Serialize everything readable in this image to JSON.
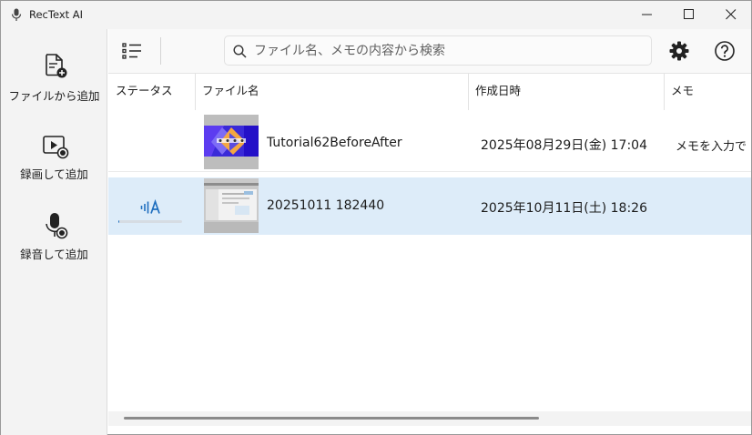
{
  "window": {
    "title": "RecText AI"
  },
  "sidebar": {
    "items": [
      {
        "label": "ファイルから追加",
        "icon": "file-add-icon"
      },
      {
        "label": "録画して追加",
        "icon": "screen-record-icon"
      },
      {
        "label": "録音して追加",
        "icon": "microphone-record-icon"
      }
    ]
  },
  "toolbar": {
    "list_icon": "list-view-icon",
    "search_placeholder": "ファイル名、メモの内容から検索",
    "search_value": "",
    "settings_icon": "gear-icon",
    "help_icon": "help-icon"
  },
  "table": {
    "columns": [
      "ステータス",
      "ファイル名",
      "作成日時",
      "メモ"
    ],
    "rows": [
      {
        "status": "",
        "filename": "Tutorial62BeforeAfter",
        "created": "2025年08月29日(金) 17:04",
        "memo": "メモを入力で",
        "selected": false,
        "thumbnail": "tutorial-thumbnail"
      },
      {
        "status": "transcribing-icon",
        "progress": 0.02,
        "filename": "20251011 182440",
        "created": "2025年10月11日(土) 18:26",
        "memo": "",
        "selected": true,
        "thumbnail": "screenshot-thumbnail"
      }
    ]
  },
  "colors": {
    "accent": "#1f6fbf",
    "selected_row": "#ddecf9",
    "sidebar_bg": "#f3f3f3"
  }
}
